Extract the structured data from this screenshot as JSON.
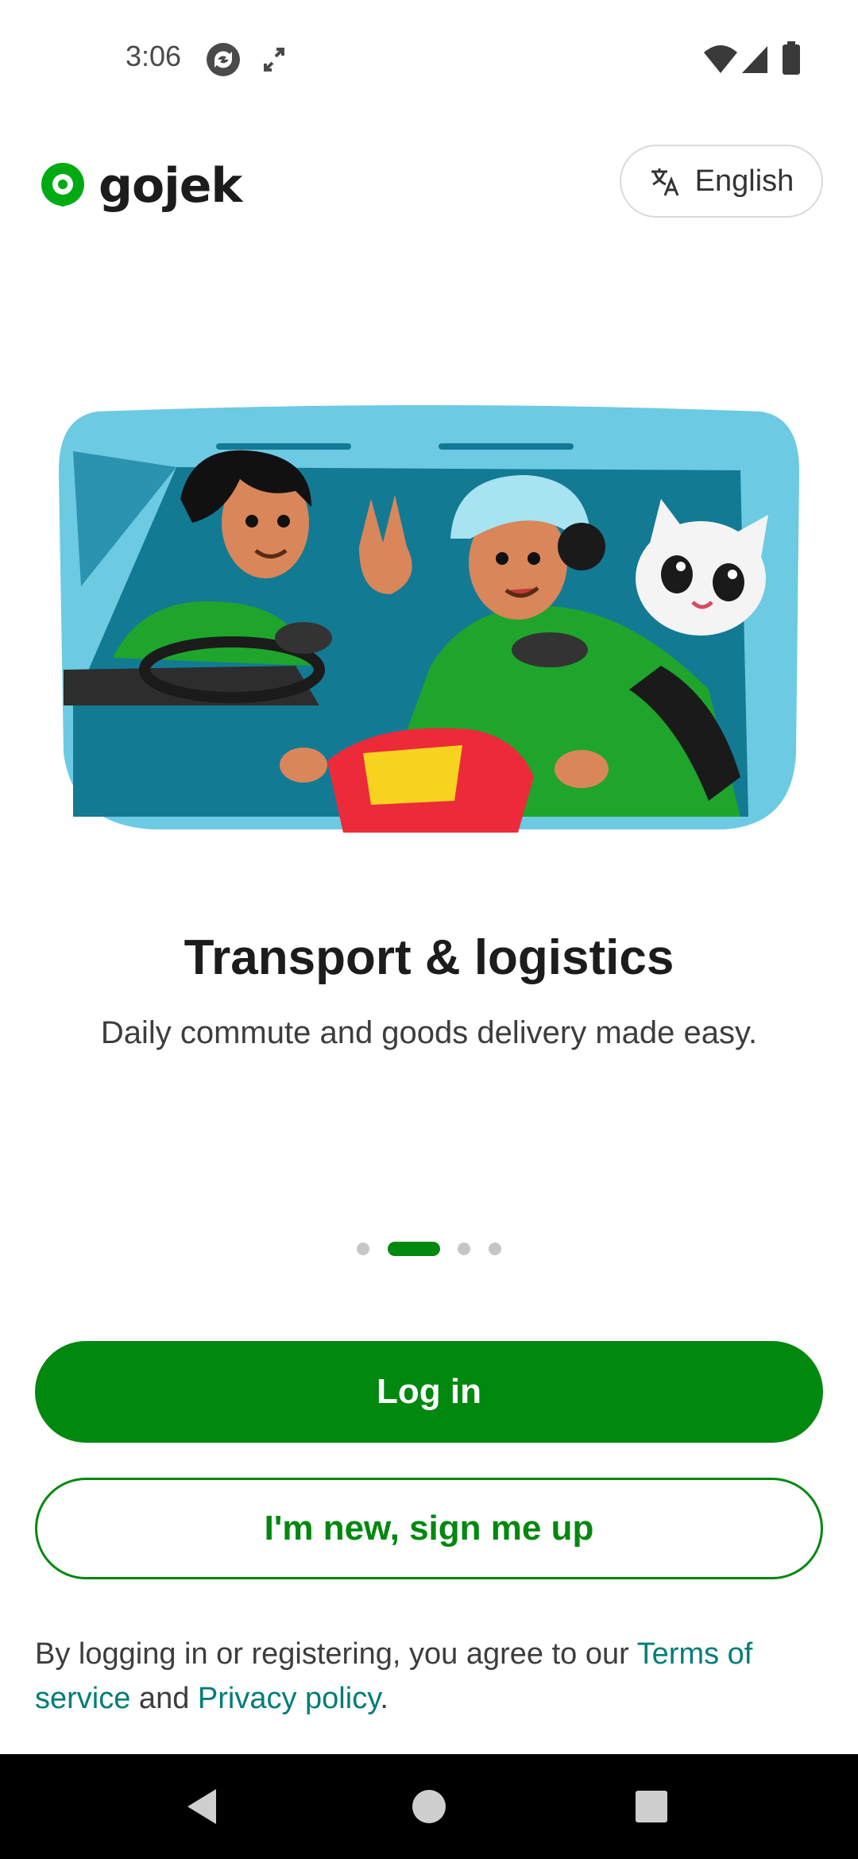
{
  "status_bar": {
    "time": "3:06",
    "icons": [
      "sync-icon",
      "fullscreen-arrows-icon",
      "wifi-icon",
      "signal-icon",
      "battery-icon"
    ]
  },
  "header": {
    "logo_text": "gojek",
    "language_label": "English",
    "language_icon": "translate-icon"
  },
  "hero": {
    "illustration": "car-and-scooter-rider-illustration"
  },
  "slide": {
    "title": "Transport & logistics",
    "subtitle": "Daily commute and goods delivery made easy.",
    "active_index": 1,
    "count": 4
  },
  "actions": {
    "login_label": "Log in",
    "signup_label": "I'm new, sign me up"
  },
  "legal": {
    "prefix": "By logging in or registering, you agree to our ",
    "terms_link": "Terms of service",
    "middle": " and ",
    "privacy_link": "Privacy policy",
    "suffix": "."
  },
  "colors": {
    "brand_green": "#00880f",
    "link_teal": "#007d77"
  },
  "nav_bar": {
    "buttons": [
      "back-icon",
      "home-icon",
      "recents-icon"
    ]
  }
}
